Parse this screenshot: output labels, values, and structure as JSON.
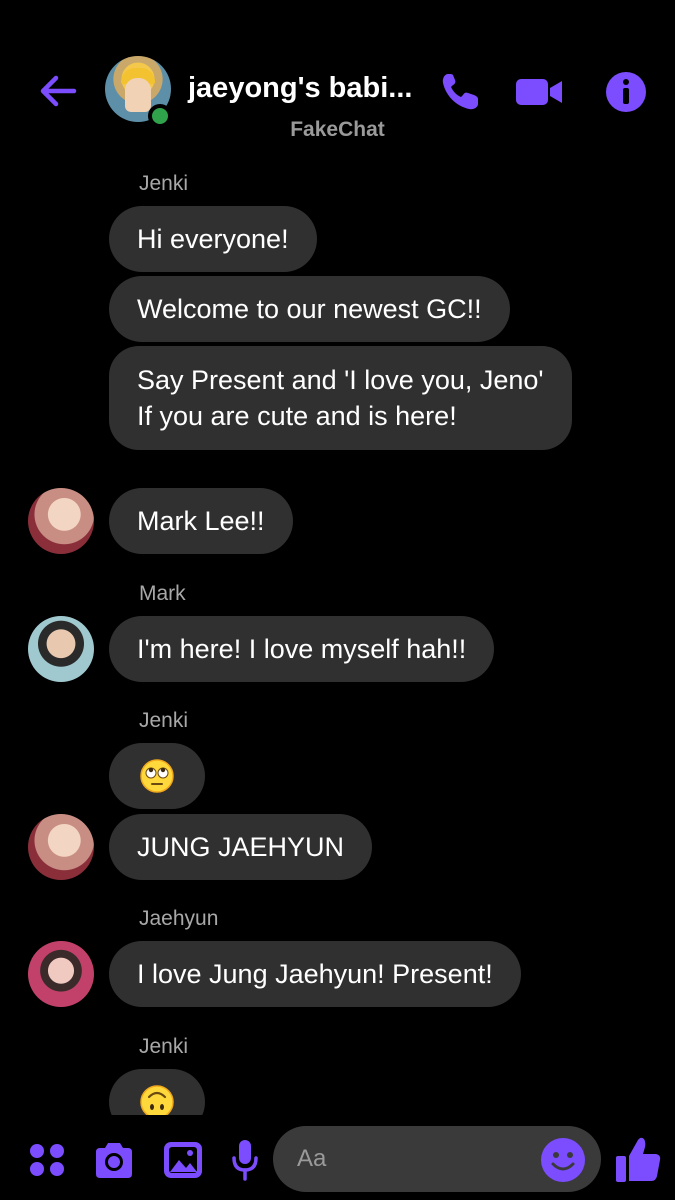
{
  "theme": {
    "accent": "#7c4dff",
    "bubble_bg": "#303030",
    "background": "#000000",
    "online": "#31a24c"
  },
  "header": {
    "title": "jaeyong's babi...",
    "subtitle": "FakeChat",
    "icons": [
      "back-arrow-icon",
      "phone-icon",
      "video-camera-icon",
      "info-icon"
    ]
  },
  "messages": [
    {
      "sender": "Jenki",
      "text": "Hi everyone!"
    },
    {
      "text": "Welcome to our newest GC!!"
    },
    {
      "text": "Say Present and 'I love you, Jeno' If you are cute and is here!"
    },
    {
      "text": "Mark Lee!!"
    },
    {
      "sender": "Mark",
      "text": "I'm here! I love myself hah!!"
    },
    {
      "sender": "Jenki",
      "emoji": "face-with-rolling-eyes"
    },
    {
      "text": "JUNG JAEHYUN"
    },
    {
      "sender": "Jaehyun",
      "text": "I love Jung Jaehyun! Present!"
    },
    {
      "sender": "Jenki",
      "emoji": "upside-down-face"
    }
  ],
  "composer": {
    "placeholder": "Aa",
    "icons": [
      "apps-grid-icon",
      "camera-icon",
      "gallery-icon",
      "microphone-icon",
      "emoji-icon",
      "thumbs-up-icon"
    ]
  }
}
